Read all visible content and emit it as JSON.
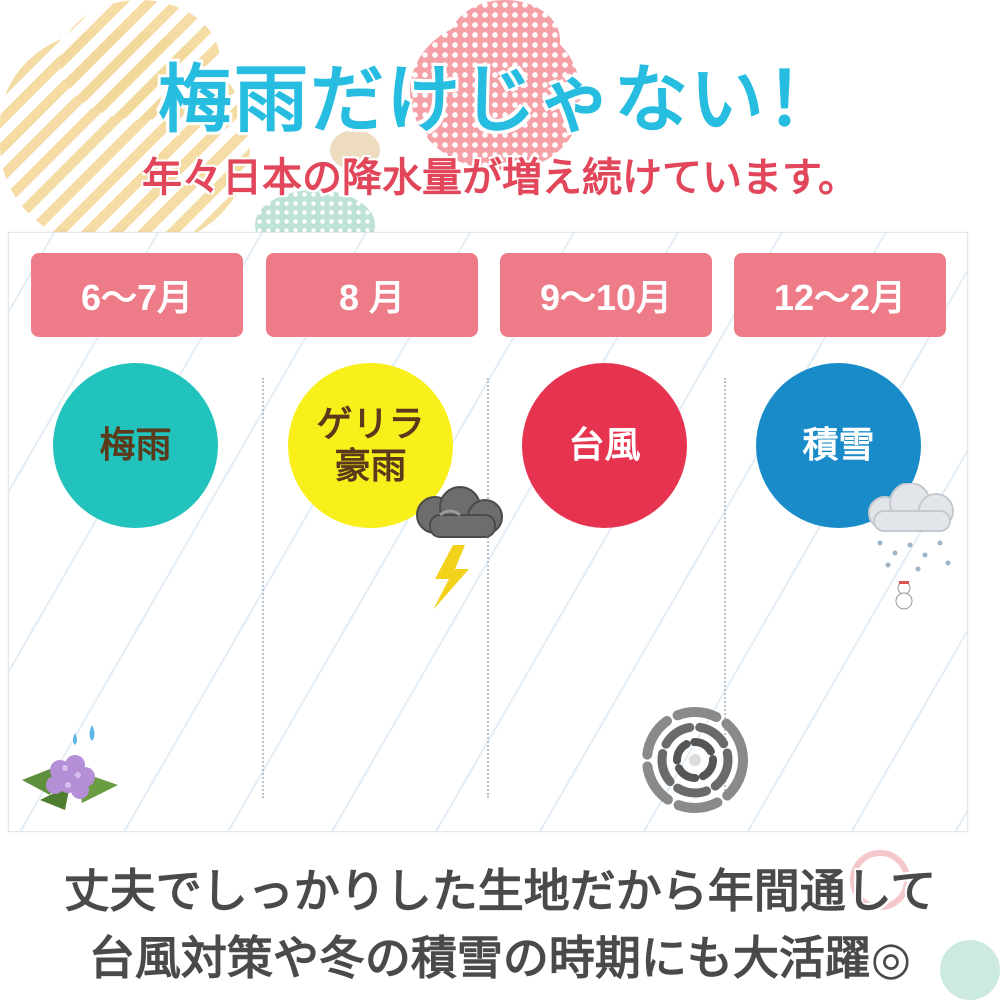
{
  "header": {
    "title": "梅雨だけじゃない！",
    "subtitle": "年々日本の降水量が増え続けています。"
  },
  "seasons": [
    {
      "month": "6～7月",
      "label_lines": [
        "梅雨"
      ],
      "color": "#22c3bd"
    },
    {
      "month": "8 月",
      "label_lines": [
        "ゲリラ",
        "豪雨"
      ],
      "color": "#f9ef1b"
    },
    {
      "month": "9～10月",
      "label_lines": [
        "台風"
      ],
      "color": "#e63450"
    },
    {
      "month": "12～2月",
      "label_lines": [
        "積雪"
      ],
      "color": "#1a8bc9"
    }
  ],
  "icons": [
    "hydrangea-icon",
    "thundercloud-icon",
    "lightning-icon",
    "typhoon-icon",
    "snow-cloud-icon",
    "snowman-icon"
  ],
  "footer": {
    "line1": "丈夫でしっかりした生地だから年間通して",
    "line2": "台風対策や冬の積雪の時期にも大活躍◎"
  },
  "colors": {
    "title": "#27bde0",
    "subtitle": "#e1465a",
    "month_tab": "#ee7b88",
    "footer_text": "#4a4a4a"
  }
}
